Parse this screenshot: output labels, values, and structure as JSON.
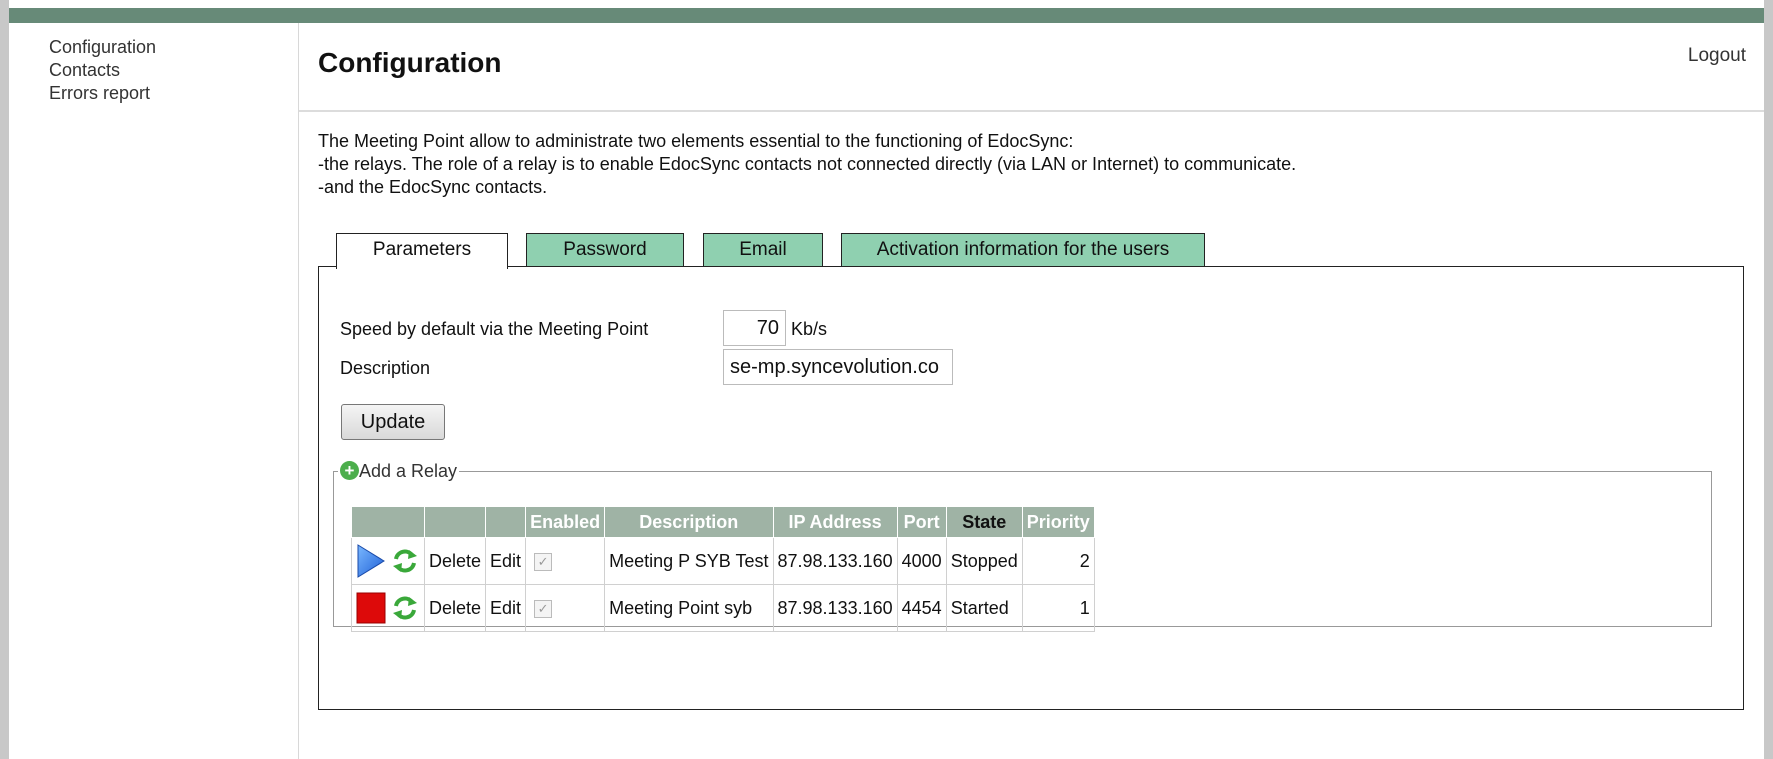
{
  "sidebar": {
    "items": [
      {
        "label": "Configuration"
      },
      {
        "label": "Contacts"
      },
      {
        "label": "Errors report"
      }
    ]
  },
  "header": {
    "title": "Configuration",
    "logout": "Logout"
  },
  "intro": {
    "line1": "The Meeting Point allow to administrate two elements essential to the functioning of EdocSync:",
    "line2": "-the relays. The role of a relay is to enable EdocSync contacts not connected directly (via LAN or Internet) to communicate.",
    "line3": "-and the EdocSync contacts."
  },
  "tabs": [
    {
      "label": "Parameters",
      "active": true
    },
    {
      "label": "Password",
      "active": false
    },
    {
      "label": "Email",
      "active": false
    },
    {
      "label": "Activation information for the users",
      "active": false
    }
  ],
  "params": {
    "speed_label": "Speed by default via the Meeting Point",
    "speed_value": "70",
    "speed_unit": "Kb/s",
    "description_label": "Description",
    "description_value": "se-mp.syncevolution.co",
    "update_label": "Update"
  },
  "relays": {
    "legend": "Add a Relay",
    "columns": {
      "enabled": "Enabled",
      "description": "Description",
      "ip": "IP Address",
      "port": "Port",
      "state": "State",
      "priority": "Priority"
    },
    "rows": [
      {
        "control_icon": "play-icon",
        "delete": "Delete",
        "edit": "Edit",
        "description": "Meeting P SYB Test",
        "ip": "87.98.133.160",
        "port": "4000",
        "state": "Stopped",
        "priority": "2"
      },
      {
        "control_icon": "stop-icon",
        "delete": "Delete",
        "edit": "Edit",
        "description": "Meeting Point syb",
        "ip": "87.98.133.160",
        "port": "4454",
        "state": "Started",
        "priority": "1"
      }
    ]
  },
  "colors": {
    "topbar": "#678a78",
    "tab_inactive": "#8fd0b0",
    "table_header": "#9fb3a5"
  }
}
